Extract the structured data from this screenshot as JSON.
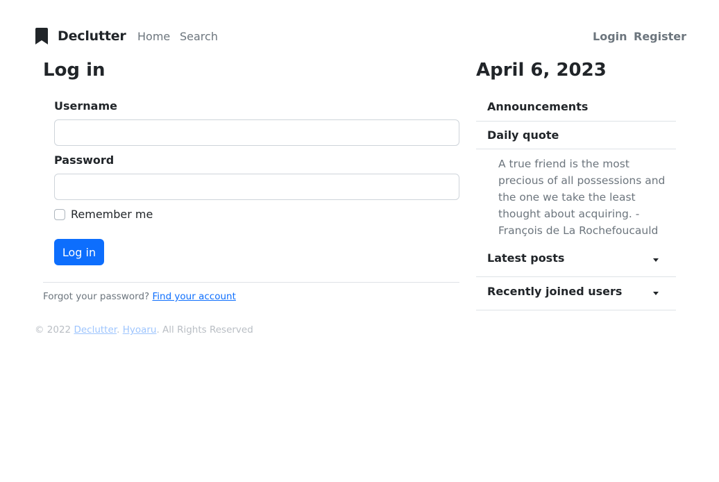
{
  "navbar": {
    "brand": "Declutter",
    "brand_icon": "bookmark-icon",
    "links": {
      "home": "Home",
      "search": "Search",
      "login": "Login",
      "register": "Register"
    }
  },
  "login_form": {
    "title": "Log in",
    "username_label": "Username",
    "username_value": "",
    "password_label": "Password",
    "password_value": "",
    "remember_label": "Remember me",
    "remember_checked": false,
    "submit_label": "Log in",
    "forgot_text": "Forgot your password?",
    "forgot_link": "Find your account"
  },
  "footer": {
    "prefix": "© 2022",
    "site_link": "Declutter",
    "sep": ".",
    "author_link": "Hyoaru",
    "suffix": ". All Rights Reserved"
  },
  "sidebar": {
    "date": "April 6, 2023",
    "announcements": "Announcements",
    "daily_quote_label": "Daily quote",
    "daily_quote_text": "A true friend is the most precious of all possessions and the one we take the least thought about acquiring. - François de La Rochefoucauld",
    "latest_posts": "Latest posts",
    "recent_users": "Recently joined users"
  },
  "colors": {
    "primary": "#0d6efd",
    "text": "#212529",
    "muted": "#6c757d",
    "border": "#dee2e6"
  }
}
